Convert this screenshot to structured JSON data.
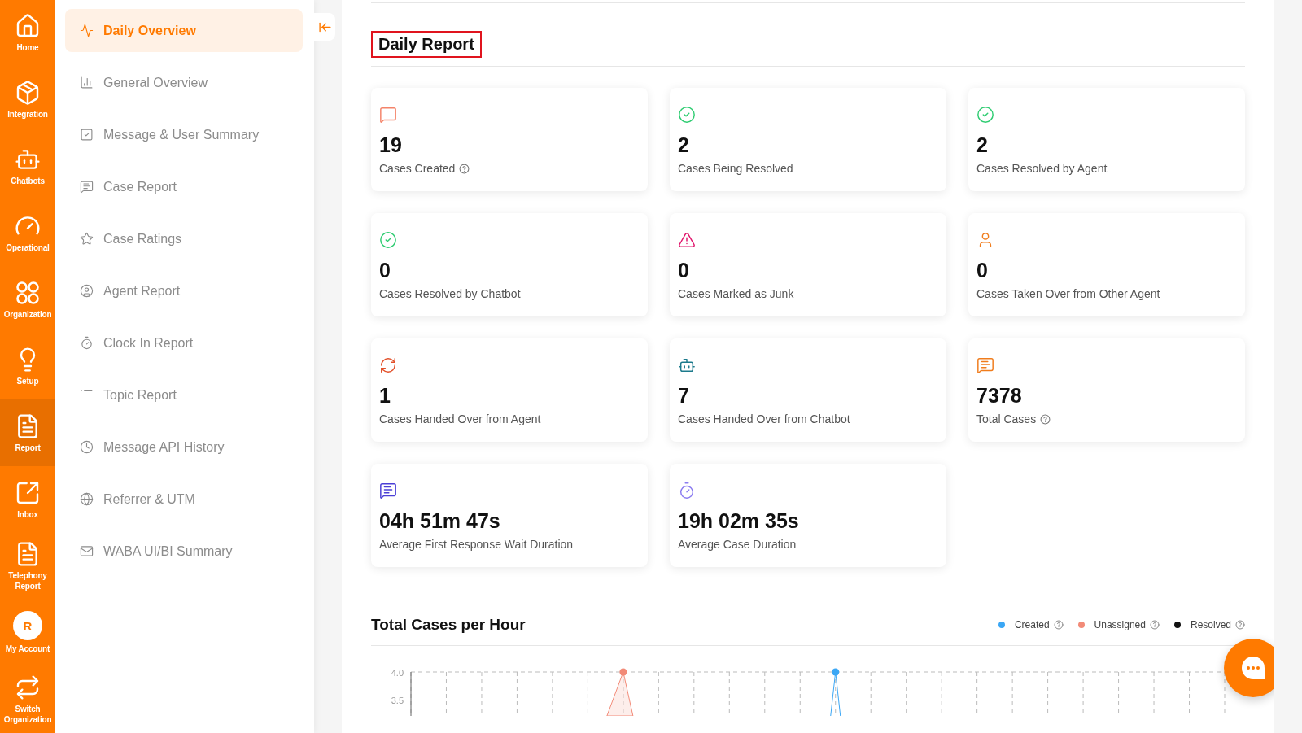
{
  "rail": [
    {
      "label": "Home",
      "kind": "home",
      "selected": false
    },
    {
      "label": "Integration",
      "kind": "package",
      "selected": false
    },
    {
      "label": "Chatbots",
      "kind": "bot",
      "selected": false
    },
    {
      "label": "Operational",
      "kind": "gauge",
      "selected": false
    },
    {
      "label": "Organization",
      "kind": "circles",
      "selected": false
    },
    {
      "label": "Setup",
      "kind": "bulb",
      "selected": false
    },
    {
      "label": "Report",
      "kind": "file",
      "selected": true
    },
    {
      "label": "Inbox",
      "kind": "external",
      "selected": false
    },
    {
      "label": "Telephony Report",
      "kind": "file",
      "selected": false
    },
    {
      "label": "My Account",
      "kind": "avatar",
      "avatar": "R",
      "selected": false
    },
    {
      "label": "Switch Organization",
      "kind": "switch",
      "selected": false
    }
  ],
  "submenu": [
    {
      "label": "Daily Overview",
      "kind": "activity",
      "selected": true
    },
    {
      "label": "General Overview",
      "kind": "chart",
      "selected": false
    },
    {
      "label": "Message & User Summary",
      "kind": "check",
      "selected": false
    },
    {
      "label": "Case Report",
      "kind": "message",
      "selected": false
    },
    {
      "label": "Case Ratings",
      "kind": "star",
      "selected": false
    },
    {
      "label": "Agent Report",
      "kind": "user",
      "selected": false
    },
    {
      "label": "Clock In Report",
      "kind": "timer",
      "selected": false
    },
    {
      "label": "Topic Report",
      "kind": "list",
      "selected": false
    },
    {
      "label": "Message API History",
      "kind": "clock",
      "selected": false
    },
    {
      "label": "Referrer & UTM",
      "kind": "globe",
      "selected": false
    },
    {
      "label": "WABA UI/BI Summary",
      "kind": "mail",
      "selected": false
    }
  ],
  "page_title": "Daily Report",
  "cards": [
    {
      "value": "19",
      "label": "Cases Created",
      "kind": "message",
      "color": "#f4846a",
      "help": true
    },
    {
      "value": "2",
      "label": "Cases Being Resolved",
      "kind": "check",
      "color": "#2ecc71",
      "help": false
    },
    {
      "value": "2",
      "label": "Cases Resolved by Agent",
      "kind": "check",
      "color": "#2ecc71",
      "help": false
    },
    {
      "value": "0",
      "label": "Cases Resolved by Chatbot",
      "kind": "check",
      "color": "#2ecc71",
      "help": false
    },
    {
      "value": "0",
      "label": "Cases Marked as Junk",
      "kind": "warning",
      "color": "#e0156b",
      "help": false
    },
    {
      "value": "0",
      "label": "Cases Taken Over from Other Agent",
      "kind": "user",
      "color": "#f07c1c",
      "help": false
    },
    {
      "value": "1",
      "label": "Cases Handed Over from Agent",
      "kind": "refresh",
      "color": "#e2502a",
      "help": false
    },
    {
      "value": "7",
      "label": "Cases Handed Over from Chatbot",
      "kind": "bot",
      "color": "#1c7a8c",
      "help": false
    },
    {
      "value": "7378",
      "label": "Total Cases",
      "kind": "lines",
      "color": "#f07c1c",
      "help": true
    },
    {
      "value": "04h 51m 47s",
      "label": "Average First Response Wait Duration",
      "kind": "lines",
      "color": "#4b3fd6",
      "help": false
    },
    {
      "value": "19h 02m 35s",
      "label": "Average Case Duration",
      "kind": "timer",
      "color": "#8b7cf0",
      "help": false
    }
  ],
  "chart_section": {
    "title": "Total Cases per Hour",
    "legend": [
      {
        "label": "Created",
        "color": "#3ba7f5"
      },
      {
        "label": "Unassigned",
        "color": "#f28b78"
      },
      {
        "label": "Resolved",
        "color": "#111111"
      }
    ],
    "y_tick_labels": [
      "4.0",
      "3.5"
    ]
  }
}
